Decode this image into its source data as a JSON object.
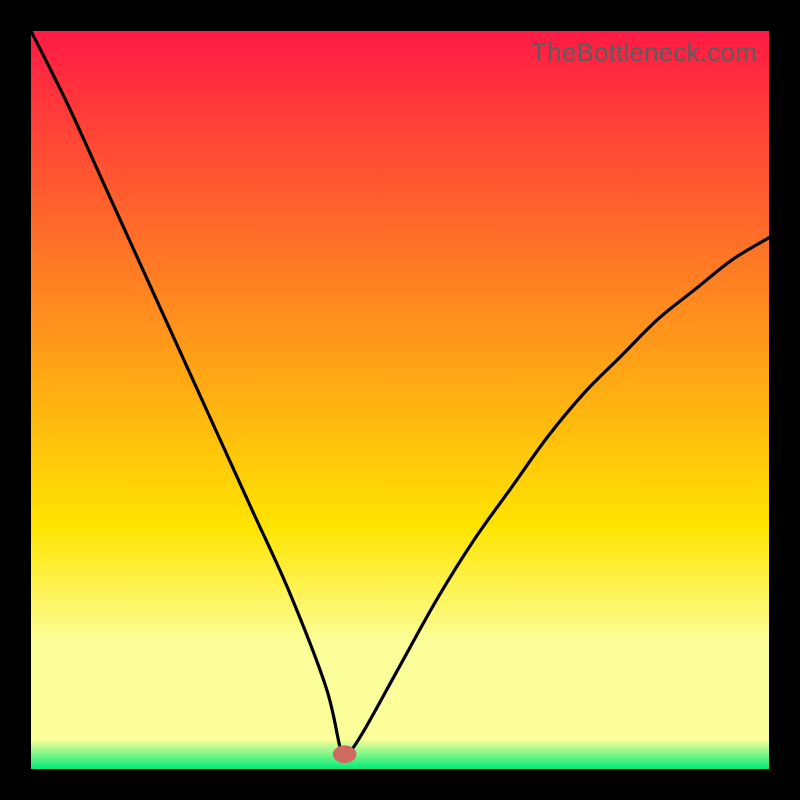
{
  "watermark": "TheBottleneck.com",
  "colors": {
    "top": "#ff1a45",
    "yellow": "#ffe400",
    "paleYellow": "#fcff9a",
    "green": "#00ec78",
    "curve": "#000000",
    "marker": "#cf6a61"
  },
  "chart_data": {
    "type": "line",
    "title": "",
    "xlabel": "",
    "ylabel": "",
    "xlim": [
      0,
      100
    ],
    "ylim": [
      0,
      100
    ],
    "series": [
      {
        "name": "bottleneck-curve",
        "x": [
          0,
          5,
          10,
          15,
          20,
          25,
          30,
          35,
          40,
          42,
          43,
          45,
          50,
          55,
          60,
          65,
          70,
          75,
          80,
          85,
          90,
          95,
          100
        ],
        "y": [
          100,
          90,
          79,
          68,
          57,
          46,
          35,
          24,
          11,
          2.5,
          2.2,
          5,
          14,
          23,
          31,
          38,
          45,
          51,
          56,
          61,
          65,
          69,
          72
        ]
      }
    ],
    "marker": {
      "x": 42.5,
      "y": 2.0,
      "rx": 1.6,
      "ry": 1.2
    },
    "gradient_stops": [
      {
        "pct": 0,
        "key": "top"
      },
      {
        "pct": 67,
        "key": "yellow"
      },
      {
        "pct": 83,
        "key": "paleYellow"
      },
      {
        "pct": 96,
        "key": "paleYellow"
      },
      {
        "pct": 100,
        "key": "green"
      }
    ]
  }
}
